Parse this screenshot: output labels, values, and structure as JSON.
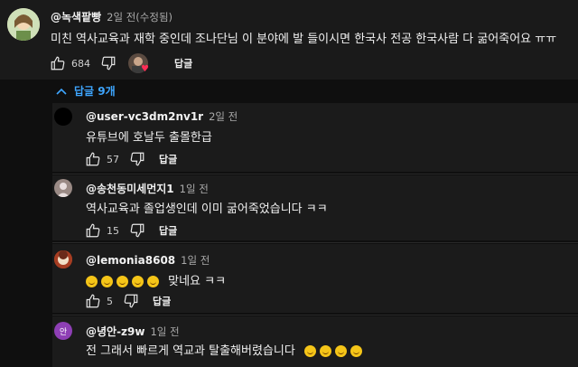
{
  "top_comment": {
    "author": "@녹색팥빵",
    "time": "2일 전(수정됨)",
    "text": "미친 역사교육과 재학 중인데 조나단님 이 분야에 발 들이시면 한국사 전공 한국사람 다 굶어죽어요 ㅠㅠ",
    "likes": "684",
    "reply_label": "답글"
  },
  "replies_toggle": {
    "label": "답글 9개"
  },
  "replies": [
    {
      "author": "@user-vc3dm2nv1r",
      "time": "2일 전",
      "text": "유튜브에 호날두 출몰한급",
      "likes": "57",
      "reply_label": "답글"
    },
    {
      "author": "@송천동미세먼지1",
      "time": "1일 전",
      "text": "역사교육과 졸업생인데 이미 굶어죽었습니다 ㅋㅋ",
      "likes": "15",
      "reply_label": "답글"
    },
    {
      "author": "@lemonia8608",
      "time": "1일 전",
      "text": "맞네요 ㅋㅋ",
      "likes": "5",
      "reply_label": "답글"
    },
    {
      "author": "@녕안-z9w",
      "time": "1일 전",
      "text": "전 그래서 빠르게 역교과 탈출해버렸습니다",
      "avatar_letter": "안"
    }
  ]
}
